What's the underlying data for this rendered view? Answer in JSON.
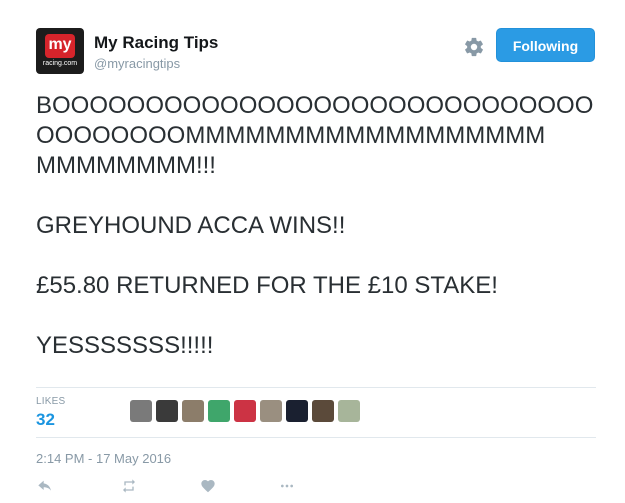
{
  "account": {
    "name": "My Racing Tips",
    "handle": "@myracingtips",
    "avatar_badge": "my",
    "avatar_site": "racing.com"
  },
  "follow_button": {
    "label": "Following"
  },
  "tweet": {
    "lines": [
      "BOOOOOOOOOOOOOOOOOOOOOOOOOOOOO",
      "OOOOOOOOMMMMMMMMMMMMMMMMMM",
      "MMMMMMMM!!!",
      "GREYHOUND ACCA WINS!!",
      "£55.80 RETURNED FOR THE £10 STAKE!",
      "YESSSSSSS!!!!!"
    ]
  },
  "stats": {
    "likes_label": "LIKES",
    "likes_count": "32"
  },
  "likers": [
    {
      "color": "#7a7a7a"
    },
    {
      "color": "#3a3a3a"
    },
    {
      "color": "#8c7d6a"
    },
    {
      "color": "#3fa66b"
    },
    {
      "color": "#cc3344"
    },
    {
      "color": "#9a8f80"
    },
    {
      "color": "#1a2030"
    },
    {
      "color": "#5b4a3a"
    },
    {
      "color": "#a7b59a"
    }
  ],
  "timestamp": "2:14 PM - 17 May 2016",
  "colors": {
    "accent": "#1b95e0",
    "follow_bg": "#2b9be4",
    "muted": "#8899a6"
  }
}
